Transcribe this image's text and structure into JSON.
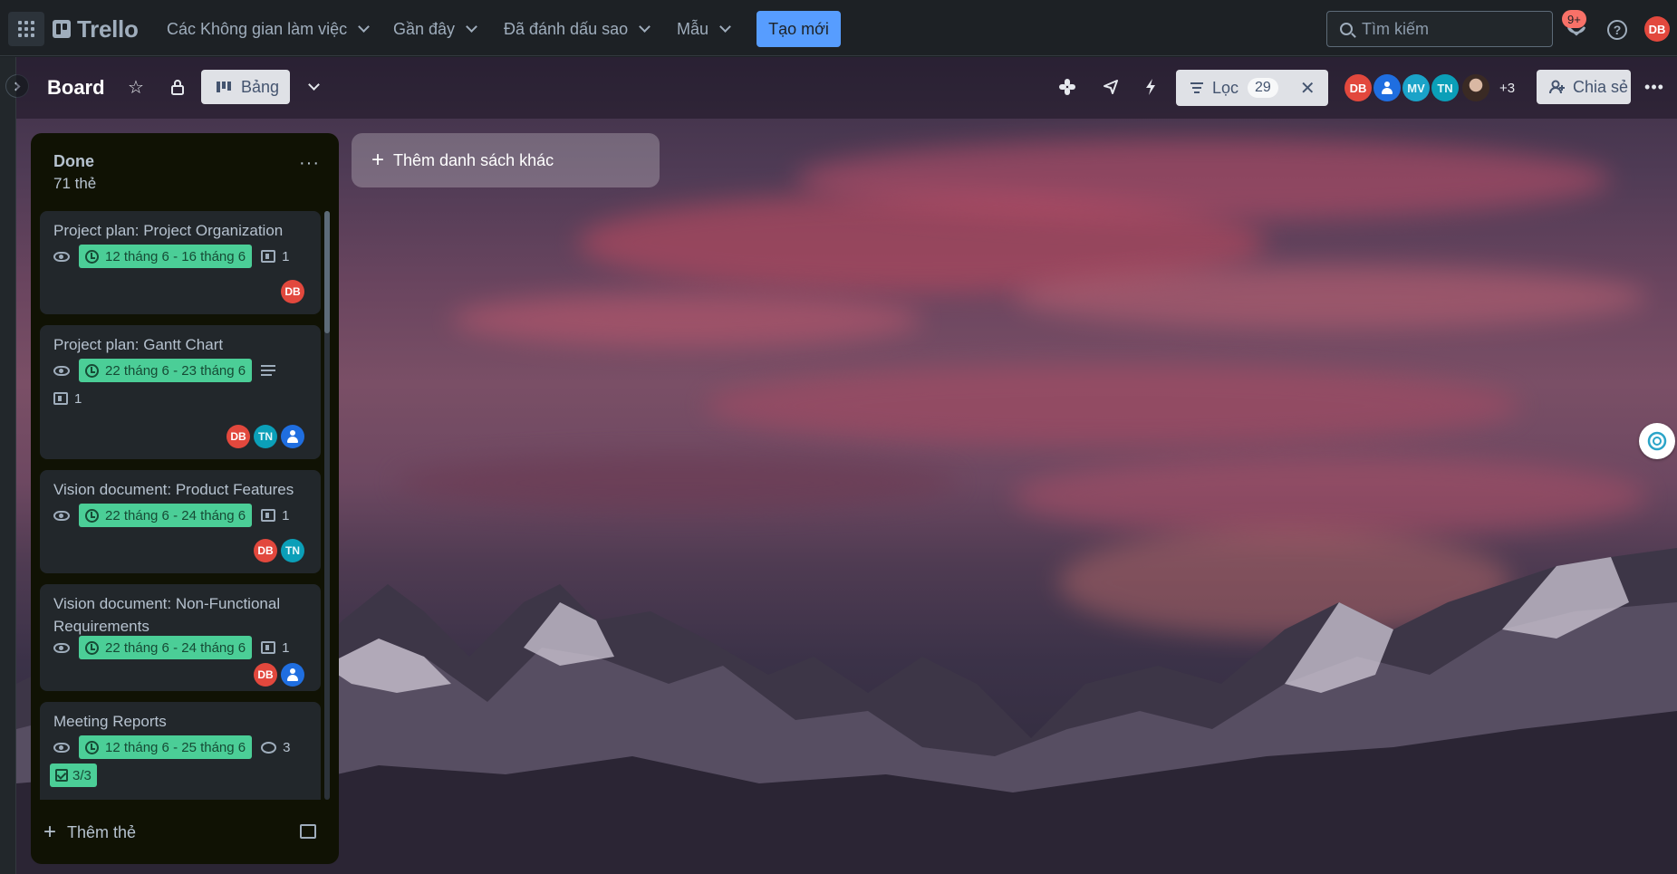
{
  "topnav": {
    "logo": "Trello",
    "menus": [
      "Các Không gian làm việc",
      "Gần đây",
      "Đã đánh dấu sao",
      "Mẫu"
    ],
    "create_label": "Tạo mới",
    "search_placeholder": "Tìm kiếm",
    "notification_badge": "9+",
    "help_label": "?",
    "user_initials": "DB"
  },
  "board": {
    "title": "Board",
    "view_label": "Bảng",
    "filter_label": "Lọc",
    "filter_count": "29",
    "members": [
      "DB",
      "MV",
      "TN"
    ],
    "members_more": "+3",
    "share_label": "Chia sẻ"
  },
  "list": {
    "title": "Done",
    "count": "71 thẻ",
    "add_card_label": "Thêm thẻ",
    "cards": [
      {
        "title": "Project plan: Project Organization",
        "due": "12 tháng 6 - 16 tháng 6",
        "attachments": "1",
        "members": [
          "DB"
        ]
      },
      {
        "title": "Project plan: Gantt Chart",
        "due": "22 tháng 6 - 23 tháng 6",
        "attachments": "1",
        "members": [
          "DB",
          "TN"
        ]
      },
      {
        "title": "Vision document: Product Features",
        "due": "22 tháng 6 - 24 tháng 6",
        "attachments": "1",
        "members": [
          "DB",
          "TN"
        ]
      },
      {
        "title": "Vision document: Non-Functional Requirements",
        "due": "22 tháng 6 - 24 tháng 6",
        "attachments": "1",
        "members": [
          "DB"
        ]
      },
      {
        "title": "Meeting Reports",
        "due": "12 tháng 6 - 25 tháng 6",
        "comments": "3",
        "checklist": "3/3"
      }
    ]
  },
  "add_list_label": "Thêm danh sách khác",
  "colors": {
    "accent": "#579dff",
    "due_green": "#4bce97",
    "avatar_red": "#e2483d",
    "avatar_teal": "#0b9fb8"
  }
}
